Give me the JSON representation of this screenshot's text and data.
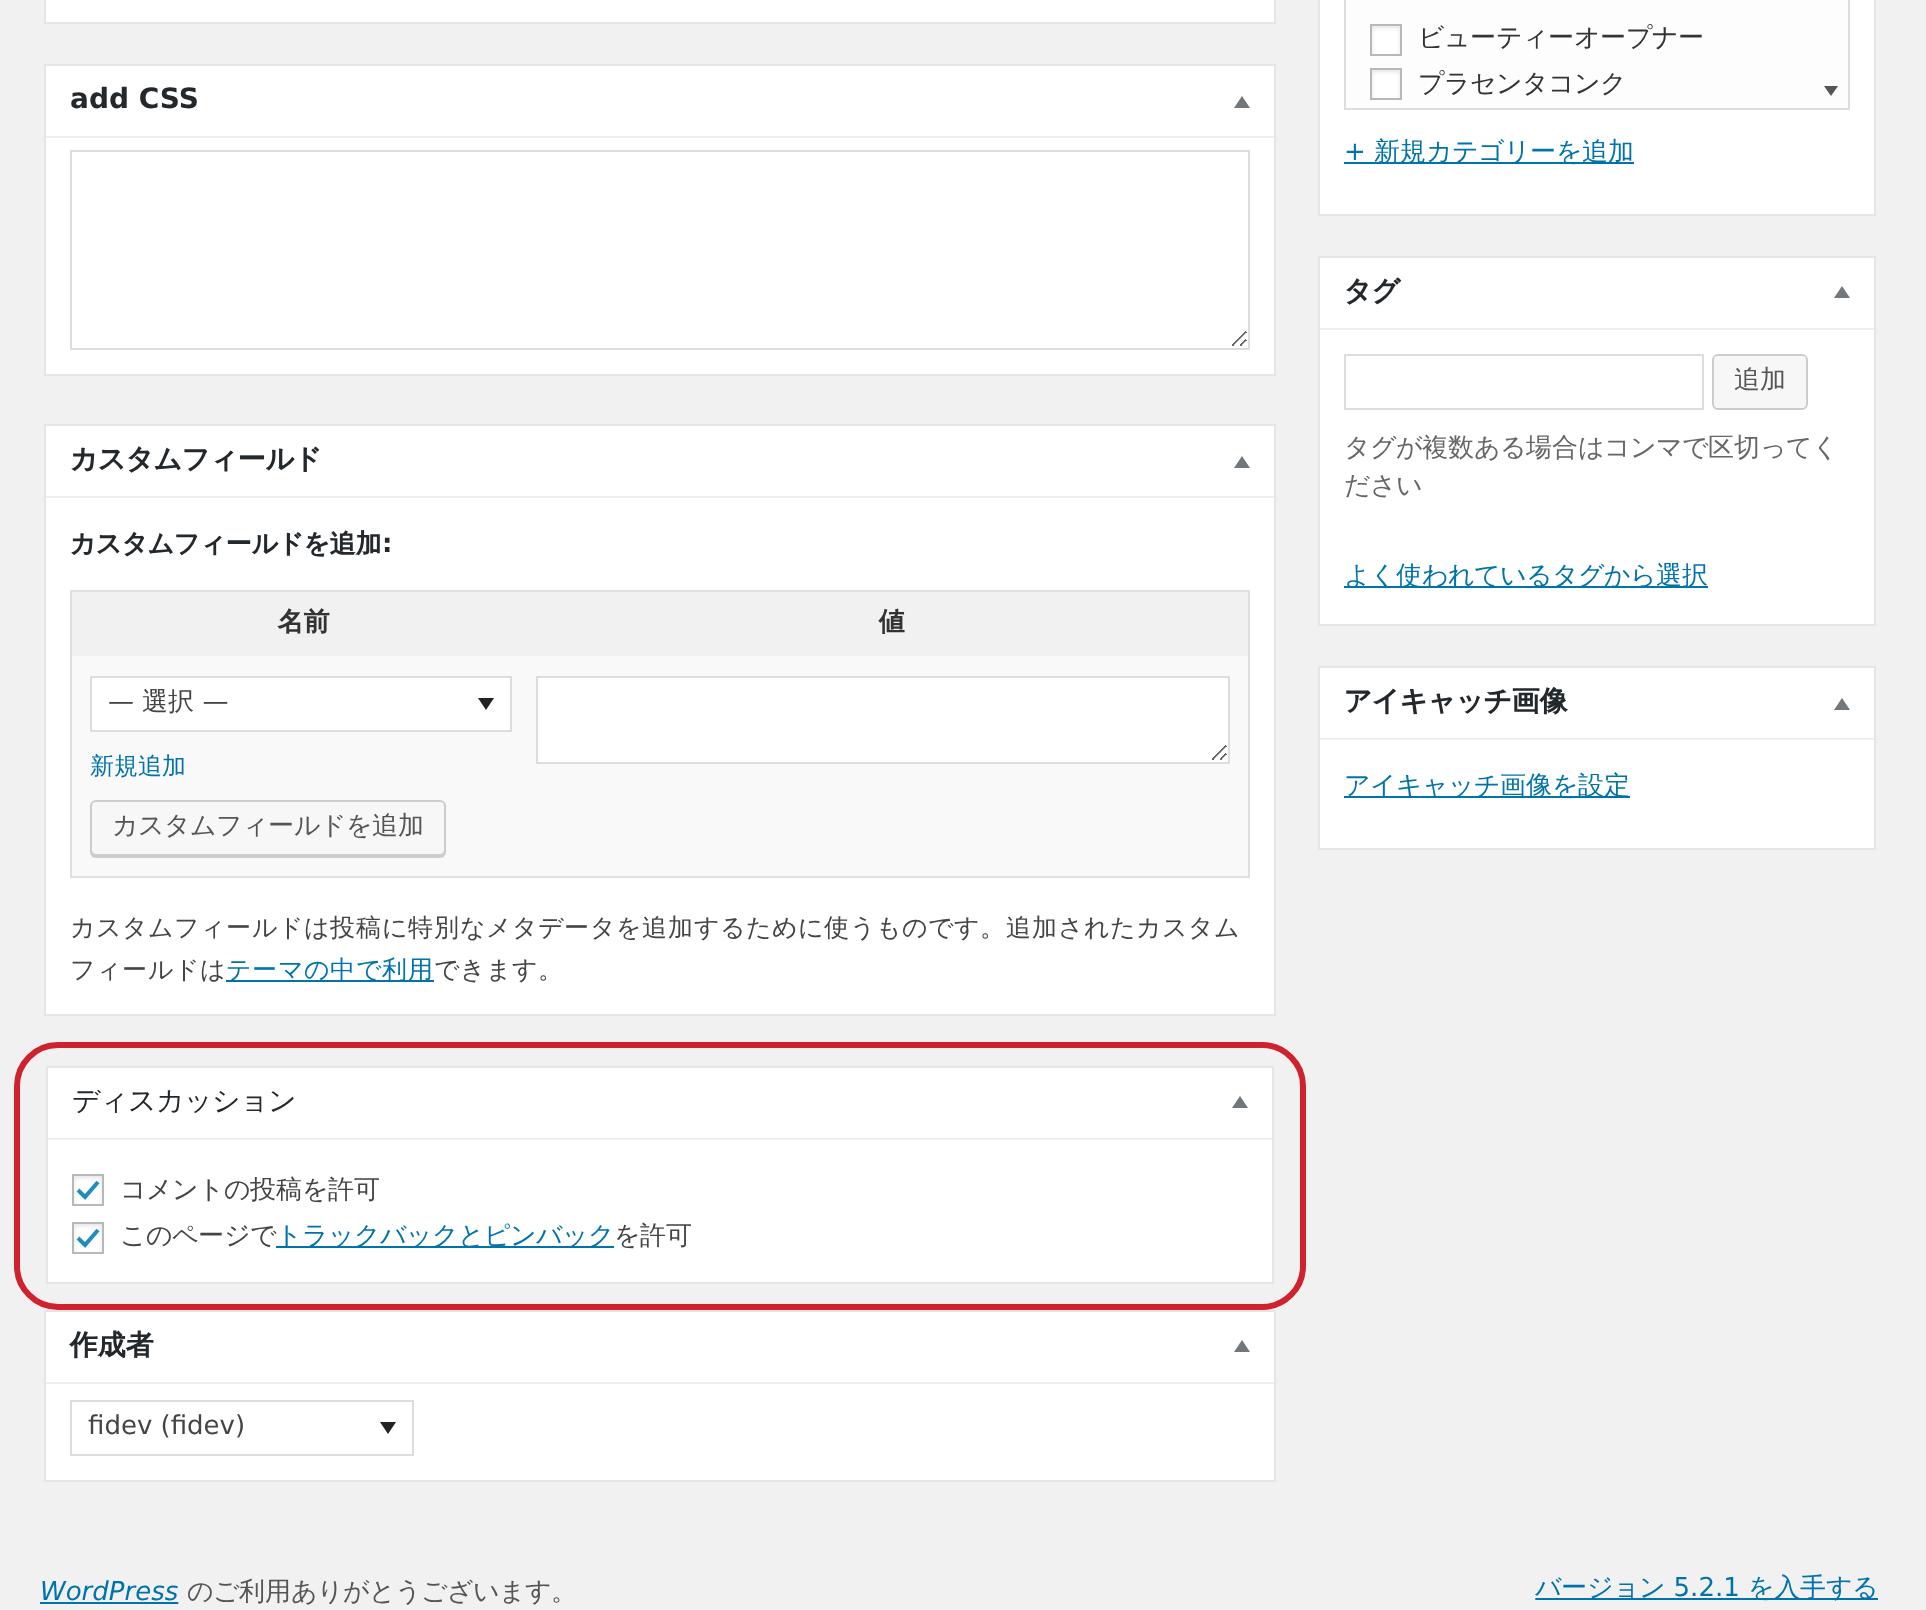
{
  "add_css": {
    "title": "add CSS"
  },
  "custom_fields": {
    "title": "カスタムフィールド",
    "subtitle": "カスタムフィールドを追加:",
    "columns": [
      "名前",
      "値"
    ],
    "select_value": "— 選択 —",
    "new_link": "新規追加",
    "add_button": "カスタムフィールドを追加",
    "note_before": "カスタムフィールドは投稿に特別なメタデータを追加するために使うものです。追加されたカスタムフィールドは",
    "note_link": "テーマの中で利用",
    "note_after": "できます。"
  },
  "discussion": {
    "title": "ディスカッション",
    "highlighted": true,
    "options": [
      {
        "parts": [
          {
            "text": "コメントの投稿を許可",
            "link": false
          }
        ],
        "checked": true
      },
      {
        "parts": [
          {
            "text": "このページで",
            "link": false
          },
          {
            "text": "トラックバックとピンバック",
            "link": true
          },
          {
            "text": "を許可",
            "link": false
          }
        ],
        "checked": true
      }
    ]
  },
  "author": {
    "title": "作成者",
    "select_value": "fidev (fidev)"
  },
  "categories": {
    "items": [
      {
        "label": "ビューティーオープナー",
        "checked": false
      },
      {
        "label": "プラセンタコンク",
        "checked": false
      }
    ],
    "add_link": "+ 新規カテゴリーを追加"
  },
  "tags": {
    "title": "タグ",
    "add_button": "追加",
    "hint": "タグが複数ある場合はコンマで区切ってください",
    "popular_link": "よく使われているタグから選択"
  },
  "featured_image": {
    "title": "アイキャッチ画像",
    "set_link": "アイキャッチ画像を設定"
  },
  "footer": {
    "brand_link": "WordPress",
    "thanks": "のご利用ありがとうございます。",
    "version_link": "バージョン 5.2.1 を入手する"
  }
}
